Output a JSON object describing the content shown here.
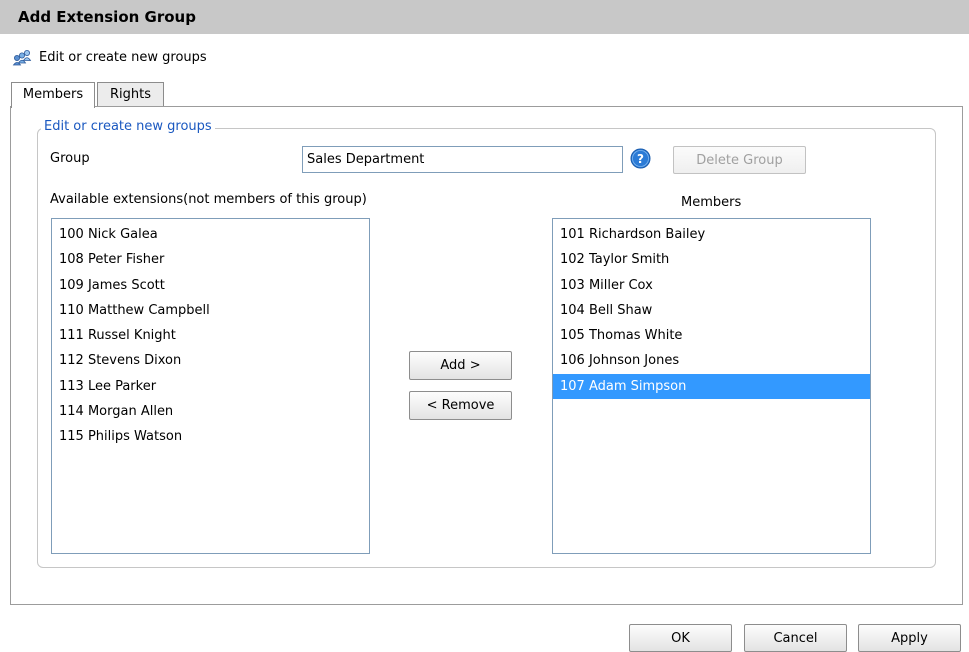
{
  "window": {
    "title": "Add Extension Group"
  },
  "header": {
    "subtitle": "Edit or create new groups",
    "icon": "users-group-icon"
  },
  "tabs": [
    {
      "label": "Members",
      "active": true
    },
    {
      "label": "Rights",
      "active": false
    }
  ],
  "form": {
    "legend": "Edit or create new groups",
    "group_label": "Group",
    "group_value": "Sales Department",
    "delete_label": "Delete Group",
    "available_label": "Available extensions(not members of this group)",
    "members_label": "Members",
    "add_label": "Add >",
    "remove_label": "< Remove"
  },
  "available": [
    "100 Nick Galea",
    "108 Peter Fisher",
    "109 James Scott",
    "110 Matthew Campbell",
    "111 Russel Knight",
    "112 Stevens Dixon",
    "113 Lee Parker",
    "114 Morgan Allen",
    "115 Philips Watson"
  ],
  "members": [
    {
      "label": "101 Richardson Bailey",
      "selected": false
    },
    {
      "label": "102 Taylor Smith",
      "selected": false
    },
    {
      "label": "103 Miller Cox",
      "selected": false
    },
    {
      "label": "104 Bell Shaw",
      "selected": false
    },
    {
      "label": "105 Thomas White",
      "selected": false
    },
    {
      "label": "106 Johnson Jones",
      "selected": false
    },
    {
      "label": "107 Adam Simpson",
      "selected": true
    }
  ],
  "footer": {
    "ok_label": "OK",
    "cancel_label": "Cancel",
    "apply_label": "Apply"
  },
  "colors": {
    "selection": "#3399ff",
    "legend": "#1a58c0",
    "titlebar": "#c8c8c8",
    "help": "#2b7bd6"
  }
}
